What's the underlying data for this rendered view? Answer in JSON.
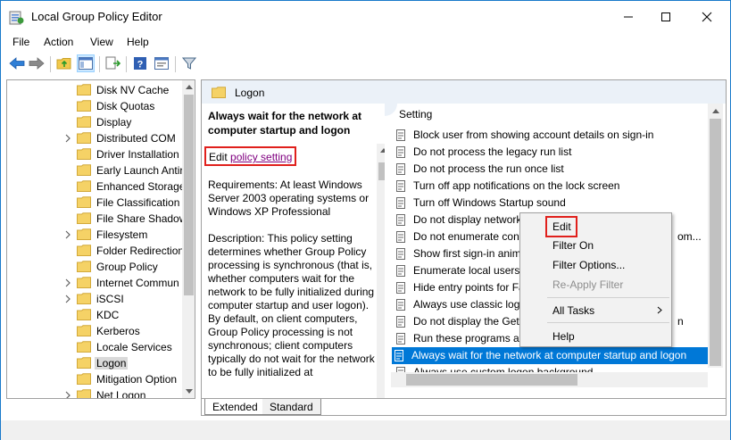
{
  "window": {
    "title": "Local Group Policy Editor"
  },
  "menu": [
    "File",
    "Action",
    "View",
    "Help"
  ],
  "tree": {
    "items": [
      {
        "label": "Disk NV Cache",
        "expandable": false
      },
      {
        "label": "Disk Quotas",
        "expandable": false
      },
      {
        "label": "Display",
        "expandable": false
      },
      {
        "label": "Distributed COM",
        "expandable": true
      },
      {
        "label": "Driver Installation",
        "expandable": false
      },
      {
        "label": "Early Launch Antir",
        "expandable": false
      },
      {
        "label": "Enhanced Storage",
        "expandable": false
      },
      {
        "label": "File Classification I",
        "expandable": false
      },
      {
        "label": "File Share Shadow",
        "expandable": false
      },
      {
        "label": "Filesystem",
        "expandable": true
      },
      {
        "label": "Folder Redirection",
        "expandable": false
      },
      {
        "label": "Group Policy",
        "expandable": false
      },
      {
        "label": "Internet Commun",
        "expandable": true
      },
      {
        "label": "iSCSI",
        "expandable": true
      },
      {
        "label": "KDC",
        "expandable": false
      },
      {
        "label": "Kerberos",
        "expandable": false
      },
      {
        "label": "Locale Services",
        "expandable": false
      },
      {
        "label": "Logon",
        "expandable": false,
        "selected": true
      },
      {
        "label": "Mitigation Option",
        "expandable": false
      },
      {
        "label": "Net Logon",
        "expandable": true
      }
    ]
  },
  "pane": {
    "header": "Logon"
  },
  "description": {
    "title": "Always wait for the network at computer startup and logon",
    "edit_prefix": "Edit ",
    "edit_link": "policy setting",
    "requirements": "Requirements: At least Windows Server 2003 operating systems or Windows XP Professional",
    "description_text": "Description: This policy setting determines whether Group Policy processing is synchronous (that is, whether computers wait for the network to be fully initialized during computer startup and user logon). By default, on client computers, Group Policy processing is not synchronous; client computers typically do not wait for the network to be fully initialized at"
  },
  "settings": {
    "column_header": "Setting",
    "rows": [
      "Block user from showing account details on sign-in",
      "Do not process the legacy run list",
      "Do not process the run once list",
      "Turn off app notifications on the lock screen",
      "Turn off Windows Startup sound",
      "Do not display network",
      "Do not enumerate conn",
      "Show first sign-in anim",
      "Enumerate local users o",
      "Hide entry points for Fa",
      "Always use classic logon",
      "Do not display the Gett",
      "Run these programs at",
      "Always wait for the network at computer startup and logon",
      "Always use custom logon background"
    ],
    "row_suffixes": {
      "6": "om...",
      "11": "n"
    },
    "selected_index": 13
  },
  "tabs": [
    "Extended",
    "Standard"
  ],
  "context_menu": {
    "items": [
      "Edit",
      "Filter On",
      "Filter Options...",
      "Re-Apply Filter",
      "All Tasks",
      "Help"
    ],
    "disabled": [
      "Re-Apply Filter"
    ]
  }
}
